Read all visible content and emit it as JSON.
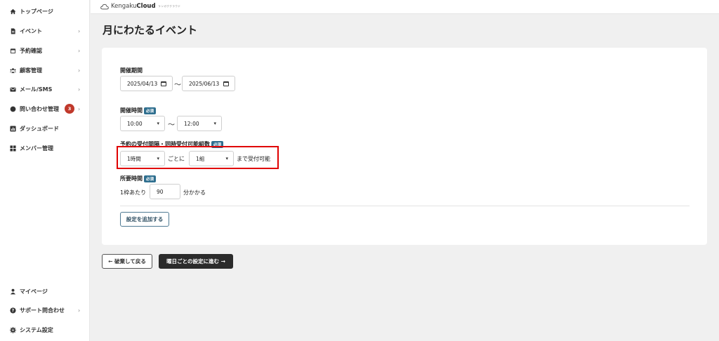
{
  "sidebar": {
    "items": [
      {
        "label": "トップページ",
        "icon": "home-icon",
        "chevron": ""
      },
      {
        "label": "イベント",
        "icon": "document-icon",
        "chevron": "›"
      },
      {
        "label": "予約確認",
        "icon": "calendar-icon",
        "chevron": "›"
      },
      {
        "label": "顧客管理",
        "icon": "users-icon",
        "chevron": "›"
      },
      {
        "label": "メール/SMS",
        "icon": "mail-icon",
        "chevron": "›"
      },
      {
        "label": "問い合わせ管理",
        "icon": "chat-icon",
        "chevron": "›",
        "badge": "3"
      },
      {
        "label": "ダッシュボード",
        "icon": "chart-icon",
        "chevron": ""
      },
      {
        "label": "メンバー管理",
        "icon": "grid-icon",
        "chevron": ""
      }
    ],
    "bottom_items": [
      {
        "label": "マイページ",
        "icon": "user-icon",
        "chevron": ""
      },
      {
        "label": "サポート問合わせ",
        "icon": "help-icon",
        "chevron": "›"
      },
      {
        "label": "システム設定",
        "icon": "gear-icon",
        "chevron": ""
      }
    ]
  },
  "header": {
    "logo_prefix": "Kengaku",
    "logo_bold": "Cloud",
    "logo_sub": "ケンガククラウド"
  },
  "page": {
    "title": "月にわたるイベント"
  },
  "form": {
    "period": {
      "label": "開催期間",
      "start": "2025/04/13",
      "separator": "〜",
      "end": "2025/06/13"
    },
    "time": {
      "label": "開催時間",
      "required": "必須",
      "start": "10:00",
      "separator": "〜",
      "end": "12:00"
    },
    "interval": {
      "label": "予約の受付間隔・同時受付可能組数",
      "required": "必須",
      "interval_value": "1時間",
      "per_text": "ごとに",
      "groups_value": "1組",
      "suffix_text": "まで受付可能"
    },
    "duration": {
      "label": "所要時間",
      "required": "必須",
      "prefix_text": "1枠あたり",
      "value": "90",
      "suffix_text": "分かかる"
    },
    "add_button": "設定を追加する"
  },
  "footer": {
    "back_button": "← 破棄して戻る",
    "next_button": "曜日ごとの設定に進む →"
  },
  "colors": {
    "badge": "#c0392b",
    "required_tag": "#2f6f8f",
    "highlight": "#e00000",
    "dark_button": "#2b2b2b"
  }
}
